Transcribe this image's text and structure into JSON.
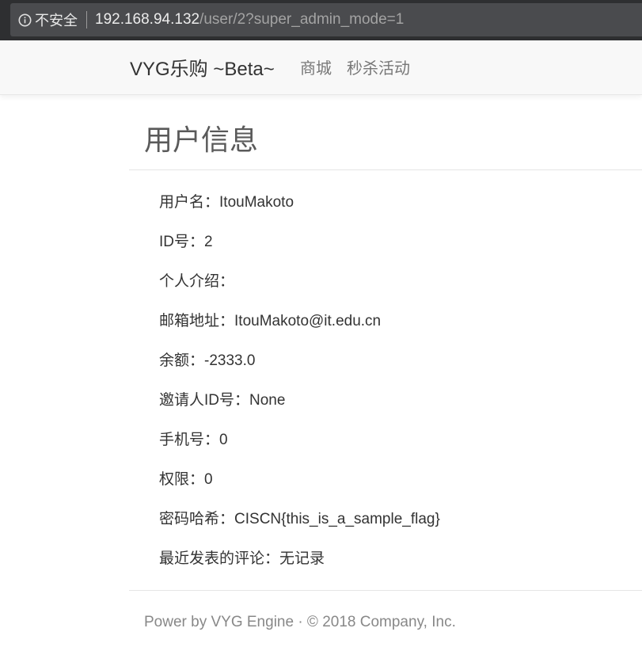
{
  "browser": {
    "security_label": "不安全",
    "url_host": "192.168.94.132",
    "url_path": "/user/2?super_admin_mode=1",
    "icon": "info-icon"
  },
  "navbar": {
    "brand": "VYG乐购 ~Beta~",
    "links": [
      "商城",
      "秒杀活动"
    ]
  },
  "page": {
    "title": "用户信息"
  },
  "user_info": [
    {
      "label": "用户名：",
      "value": "ItouMakoto"
    },
    {
      "label": "ID号：",
      "value": "2"
    },
    {
      "label": "个人介绍：",
      "value": ""
    },
    {
      "label": "邮箱地址：",
      "value": "ItouMakoto@it.edu.cn"
    },
    {
      "label": "余额：",
      "value": "-2333.0"
    },
    {
      "label": "邀请人ID号：",
      "value": "None"
    },
    {
      "label": "手机号：",
      "value": "0"
    },
    {
      "label": "权限：",
      "value": "0"
    },
    {
      "label": "密码哈希：",
      "value": "CISCN{this_is_a_sample_flag}"
    },
    {
      "label": "最近发表的评论：",
      "value": "无记录"
    }
  ],
  "footer": {
    "text": "Power by VYG Engine · © 2018 Company, Inc."
  }
}
